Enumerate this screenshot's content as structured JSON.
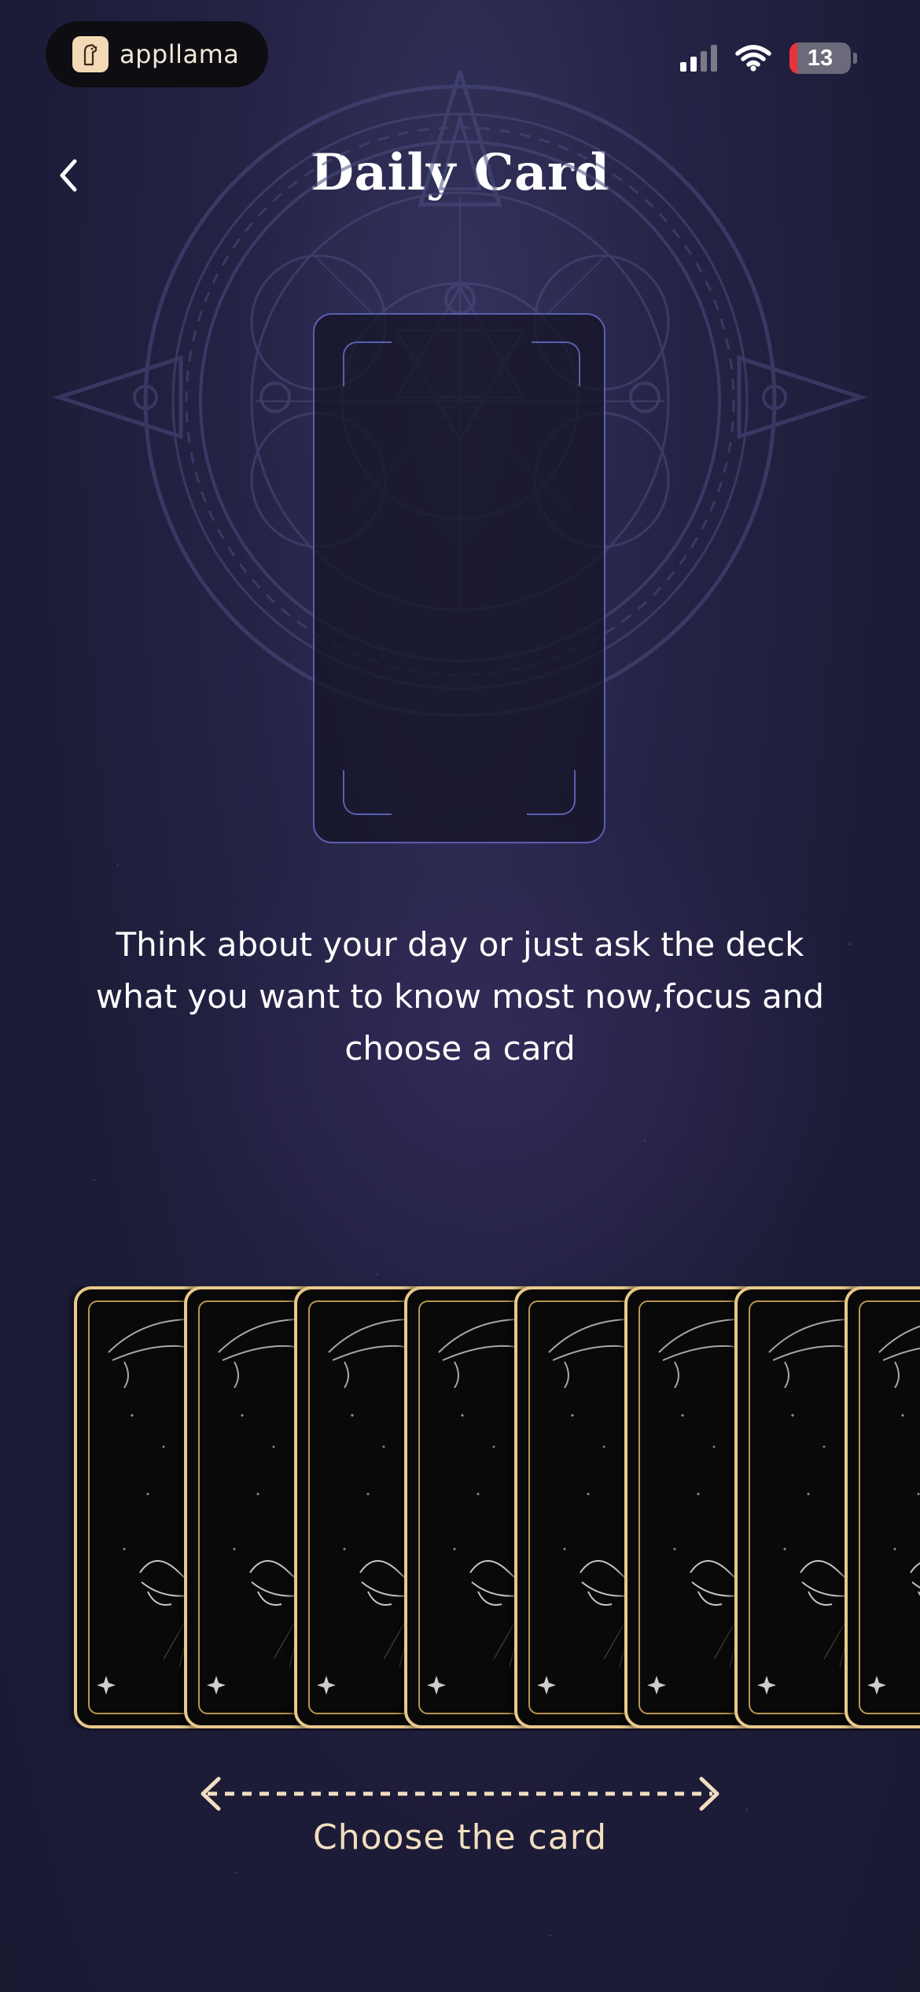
{
  "status_bar": {
    "app_name": "appllama",
    "battery_level": "13",
    "battery_fraction": 0.13,
    "signal_bars_active": 2,
    "signal_bars_total": 4
  },
  "header": {
    "title": "Daily Card",
    "back_icon": "chevron-left-icon"
  },
  "main": {
    "instructions": "Think about your day or just ask the deck what you want to know most now,focus and choose a card"
  },
  "deck": {
    "card_count": 8,
    "card_back_motif": "crescent-moon-hand-icon"
  },
  "hint": {
    "label": "Choose the card",
    "icon": "double-arrow-dashed-icon"
  },
  "colors": {
    "background": "#1d1c38",
    "card_slot_border": "#5a5fb0",
    "card_gold": "#e8c98a",
    "hint_text": "#f1dfc0"
  }
}
